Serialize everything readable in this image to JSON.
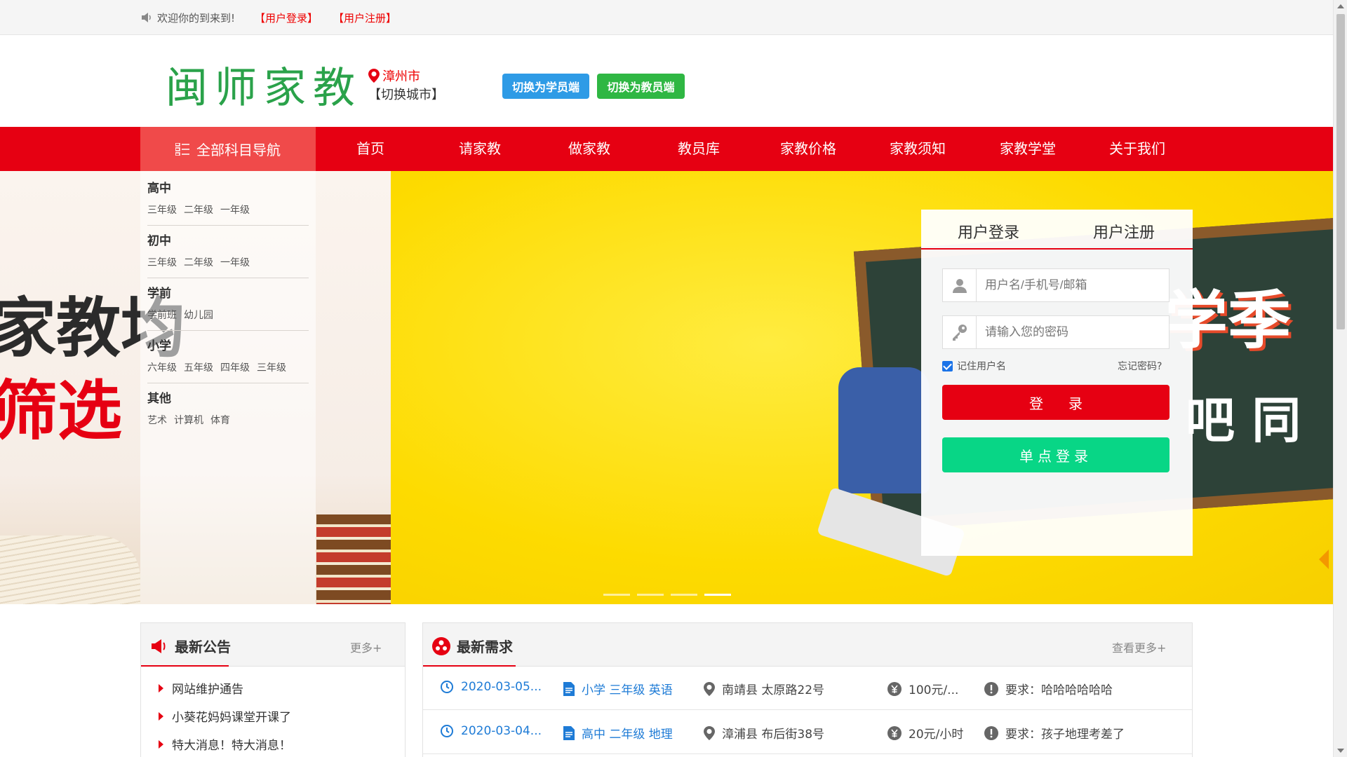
{
  "topbar": {
    "welcome": "欢迎你的到来到!",
    "login_link": "【用户登录】",
    "register_link": "【用户注册】"
  },
  "header": {
    "logo": "闽师家教",
    "city_name": "漳州市",
    "city_switch": "【切换城市】",
    "student_btn": "切换为学员端",
    "teacher_btn": "切换为教员端"
  },
  "nav": {
    "all_subjects": "全部科目导航",
    "items": [
      "首页",
      "请家教",
      "做家教",
      "教员库",
      "家教价格",
      "家教须知",
      "家教学堂",
      "关于我们"
    ]
  },
  "banner": {
    "text_line1": "家教均",
    "text_line2": "筛选",
    "chalk_line1": "学季",
    "chalk_line2": "吧 同",
    "slide_count": 4,
    "active_slide": 4
  },
  "subjects": [
    {
      "title": "高中",
      "grades": [
        "三年级",
        "二年级",
        "一年级"
      ]
    },
    {
      "title": "初中",
      "grades": [
        "三年级",
        "二年级",
        "一年级"
      ]
    },
    {
      "title": "学前",
      "grades": [
        "学前班",
        "幼儿园"
      ]
    },
    {
      "title": "小学",
      "grades": [
        "六年级",
        "五年级",
        "四年级",
        "三年级"
      ]
    },
    {
      "title": "其他",
      "grades": [
        "艺术",
        "计算机",
        "体育"
      ]
    }
  ],
  "login": {
    "tab_login": "用户登录",
    "tab_register": "用户注册",
    "username_placeholder": "用户名/手机号/邮箱",
    "password_placeholder": "请输入您的密码",
    "remember": "记住用户名",
    "remember_checked": true,
    "forgot": "忘记密码?",
    "login_btn": "登录",
    "sso_btn": "单点登录"
  },
  "notice": {
    "title": "最新公告",
    "more": "更多+",
    "items": [
      "网站维护通告",
      "小葵花妈妈课堂开课了",
      "特大消息！特大消息！"
    ]
  },
  "demand": {
    "title": "最新需求",
    "more": "查看更多+",
    "rows": [
      {
        "date": "2020-03-05...",
        "subject": "小学 三年级 英语",
        "address": "南靖县 太原路22号",
        "price": "100元/...",
        "requirement": "要求：哈哈哈哈哈哈"
      },
      {
        "date": "2020-03-04...",
        "subject": "高中 二年级 地理",
        "address": "漳浦县 布后街38号",
        "price": "20元/小时",
        "requirement": "要求：孩子地理考差了"
      }
    ]
  },
  "colors": {
    "brand_red": "#e60012",
    "logo_green": "#2aa24a",
    "student_blue": "#2e9be6",
    "teacher_green": "#2fb743",
    "sso_green": "#08d686",
    "link_blue": "#1e7bd6"
  },
  "icons": [
    "speaker-icon",
    "location-pin-icon",
    "grid-menu-icon",
    "user-icon",
    "key-icon",
    "megaphone-icon",
    "demand-icon",
    "clock-icon",
    "document-icon",
    "location-icon",
    "yuan-icon",
    "exclamation-icon",
    "triangle-bullet-icon"
  ]
}
